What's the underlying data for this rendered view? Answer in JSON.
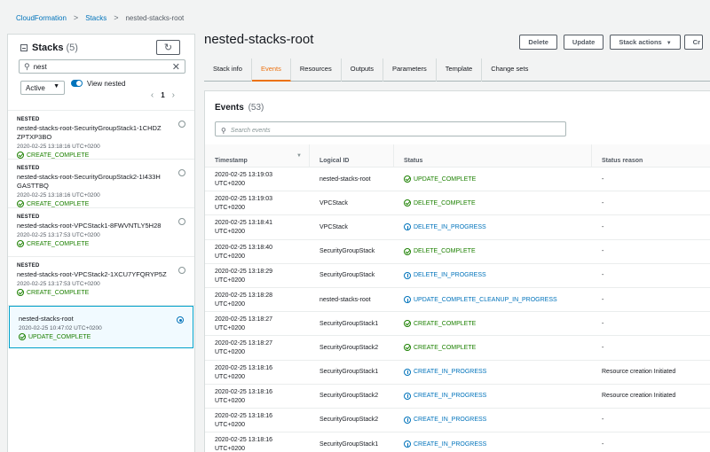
{
  "breadcrumb": {
    "items": [
      "CloudFormation",
      "Stacks"
    ],
    "current": "nested-stacks-root",
    "separator": ">"
  },
  "left_panel": {
    "title": "Stacks",
    "count": "(5)",
    "search_value": "nest",
    "filter_value": "Active",
    "toggle_label": "View nested",
    "page": "1",
    "stacks": [
      {
        "tag": "NESTED",
        "name": "nested-stacks-root-SecurityGroupStack1-1CHDZ ZPTXP3BO",
        "time": "2020-02-25 13:18:16 UTC+0200",
        "status": "CREATE_COMPLETE",
        "selected": false
      },
      {
        "tag": "NESTED",
        "name": "nested-stacks-root-SecurityGroupStack2-1I433H GASTTBQ",
        "time": "2020-02-25 13:18:16 UTC+0200",
        "status": "CREATE_COMPLETE",
        "selected": false
      },
      {
        "tag": "NESTED",
        "name": "nested-stacks-root-VPCStack1-8FWVNTLY5H28",
        "time": "2020-02-25 13:17:53 UTC+0200",
        "status": "CREATE_COMPLETE",
        "selected": false
      },
      {
        "tag": "NESTED",
        "name": "nested-stacks-root-VPCStack2-1XCU7YFQRYP5Z",
        "time": "2020-02-25 13:17:53 UTC+0200",
        "status": "CREATE_COMPLETE",
        "selected": false
      },
      {
        "tag": "",
        "name": "nested-stacks-root",
        "time": "2020-02-25 10:47:02 UTC+0200",
        "status": "UPDATE_COMPLETE",
        "selected": true
      }
    ]
  },
  "main": {
    "title": "nested-stacks-root",
    "buttons": {
      "delete": "Delete",
      "update": "Update",
      "stack_actions": "Stack actions",
      "create_stack": "Cr"
    },
    "tabs": [
      "Stack info",
      "Events",
      "Resources",
      "Outputs",
      "Parameters",
      "Template",
      "Change sets"
    ],
    "active_tab": "Events",
    "events": {
      "title": "Events",
      "count": "(53)",
      "search_placeholder": "Search events",
      "columns": [
        "Timestamp",
        "Logical ID",
        "Status",
        "Status reason"
      ],
      "rows": [
        {
          "ts1": "2020-02-25 13:19:03",
          "ts2": "UTC+0200",
          "id": "nested-stacks-root",
          "status": "UPDATE_COMPLETE",
          "kind": "ok",
          "reason": "-"
        },
        {
          "ts1": "2020-02-25 13:19:03",
          "ts2": "UTC+0200",
          "id": "VPCStack",
          "status": "DELETE_COMPLETE",
          "kind": "ok",
          "reason": "-"
        },
        {
          "ts1": "2020-02-25 13:18:41",
          "ts2": "UTC+0200",
          "id": "VPCStack",
          "status": "DELETE_IN_PROGRESS",
          "kind": "info",
          "reason": "-"
        },
        {
          "ts1": "2020-02-25 13:18:40",
          "ts2": "UTC+0200",
          "id": "SecurityGroupStack",
          "status": "DELETE_COMPLETE",
          "kind": "ok",
          "reason": "-"
        },
        {
          "ts1": "2020-02-25 13:18:29",
          "ts2": "UTC+0200",
          "id": "SecurityGroupStack",
          "status": "DELETE_IN_PROGRESS",
          "kind": "info",
          "reason": "-"
        },
        {
          "ts1": "2020-02-25 13:18:28",
          "ts2": "UTC+0200",
          "id": "nested-stacks-root",
          "status": "UPDATE_COMPLETE_CLEANUP_IN_PROGRESS",
          "kind": "info",
          "reason": "-"
        },
        {
          "ts1": "2020-02-25 13:18:27",
          "ts2": "UTC+0200",
          "id": "SecurityGroupStack1",
          "status": "CREATE_COMPLETE",
          "kind": "ok",
          "reason": "-"
        },
        {
          "ts1": "2020-02-25 13:18:27",
          "ts2": "UTC+0200",
          "id": "SecurityGroupStack2",
          "status": "CREATE_COMPLETE",
          "kind": "ok",
          "reason": "-"
        },
        {
          "ts1": "2020-02-25 13:18:16",
          "ts2": "UTC+0200",
          "id": "SecurityGroupStack1",
          "status": "CREATE_IN_PROGRESS",
          "kind": "info",
          "reason": "Resource creation Initiated"
        },
        {
          "ts1": "2020-02-25 13:18:16",
          "ts2": "UTC+0200",
          "id": "SecurityGroupStack2",
          "status": "CREATE_IN_PROGRESS",
          "kind": "info",
          "reason": "Resource creation Initiated"
        },
        {
          "ts1": "2020-02-25 13:18:16",
          "ts2": "UTC+0200",
          "id": "SecurityGroupStack2",
          "status": "CREATE_IN_PROGRESS",
          "kind": "info",
          "reason": "-"
        },
        {
          "ts1": "2020-02-25 13:18:16",
          "ts2": "UTC+0200",
          "id": "SecurityGroupStack1",
          "status": "CREATE_IN_PROGRESS",
          "kind": "info",
          "reason": "-"
        }
      ]
    }
  },
  "colors": {
    "link": "#0073bb",
    "success": "#1d8102",
    "active_tab": "#ec7211",
    "selected_border": "#00a1c9"
  }
}
